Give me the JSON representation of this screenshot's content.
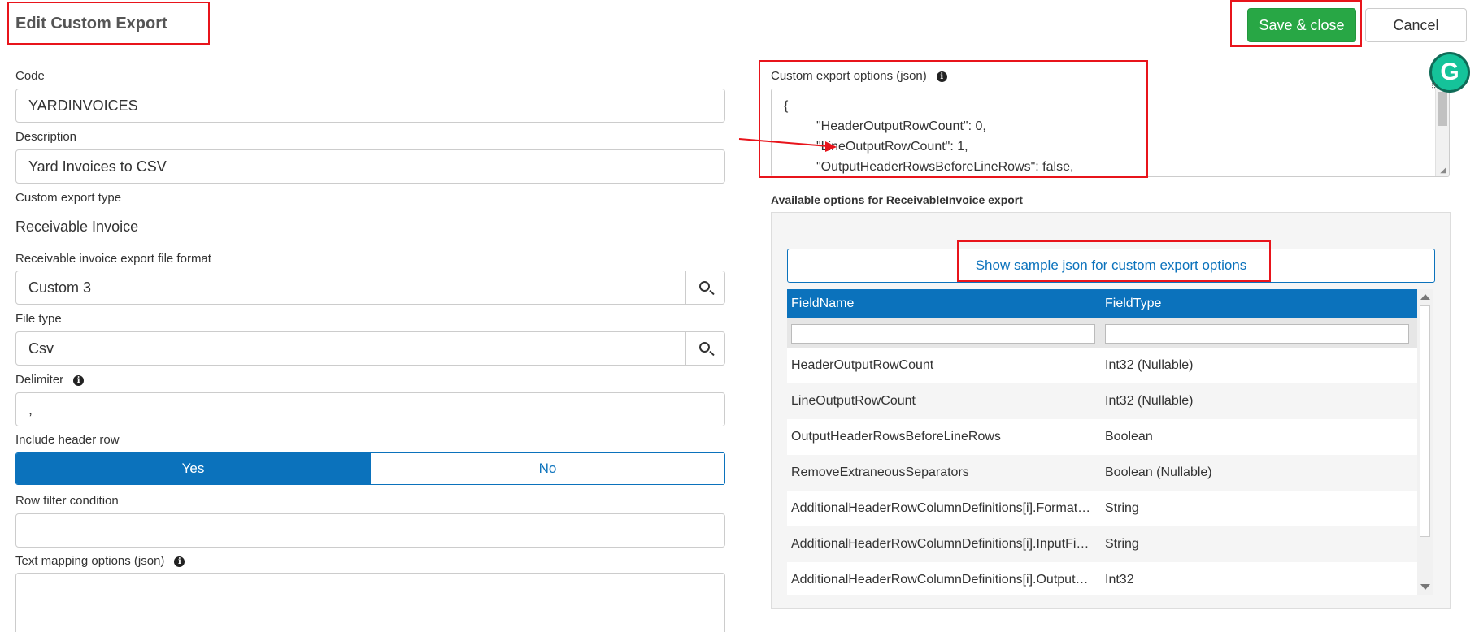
{
  "header": {
    "title": "Edit Custom Export",
    "save_label": "Save & close",
    "cancel_label": "Cancel"
  },
  "form": {
    "code_label": "Code",
    "code_value": "YARDINVOICES",
    "description_label": "Description",
    "description_value": "Yard Invoices to CSV",
    "export_type_label": "Custom export type",
    "export_type_value": "Receivable Invoice",
    "file_format_label": "Receivable invoice export file format",
    "file_format_value": "Custom 3",
    "file_type_label": "File type",
    "file_type_value": "Csv",
    "delimiter_label": "Delimiter",
    "delimiter_value": ",",
    "include_header_label": "Include header row",
    "include_header_yes": "Yes",
    "include_header_no": "No",
    "include_header_selected": "Yes",
    "row_filter_label": "Row filter condition",
    "row_filter_value": "",
    "text_mapping_label": "Text mapping options (json)"
  },
  "json_options": {
    "label": "Custom export options (json)",
    "lines": [
      "{",
      "\"HeaderOutputRowCount\": 0,",
      "\"LineOutputRowCount\": 1,",
      "\"OutputHeaderRowsBeforeLineRows\": false,"
    ]
  },
  "available": {
    "title": "Available options for ReceivableInvoice export",
    "sample_button": "Show sample json for custom export options",
    "columns": [
      "FieldName",
      "FieldType"
    ],
    "rows": [
      {
        "name": "HeaderOutputRowCount",
        "type": "Int32 (Nullable)"
      },
      {
        "name": "LineOutputRowCount",
        "type": "Int32 (Nullable)"
      },
      {
        "name": "OutputHeaderRowsBeforeLineRows",
        "type": "Boolean"
      },
      {
        "name": "RemoveExtraneousSeparators",
        "type": "Boolean (Nullable)"
      },
      {
        "name": "AdditionalHeaderRowColumnDefinitions[i].Format…",
        "type": "String"
      },
      {
        "name": "AdditionalHeaderRowColumnDefinitions[i].InputFi…",
        "type": "String"
      },
      {
        "name": "AdditionalHeaderRowColumnDefinitions[i].Output…",
        "type": "Int32"
      }
    ]
  },
  "icons": {
    "info": "info-icon",
    "search": "search-icon",
    "grammarly": "grammarly-icon",
    "grammarly_letter": "G"
  },
  "colors": {
    "primary": "#0b72bc",
    "save": "#28a745",
    "annotation": "#e8141b"
  }
}
